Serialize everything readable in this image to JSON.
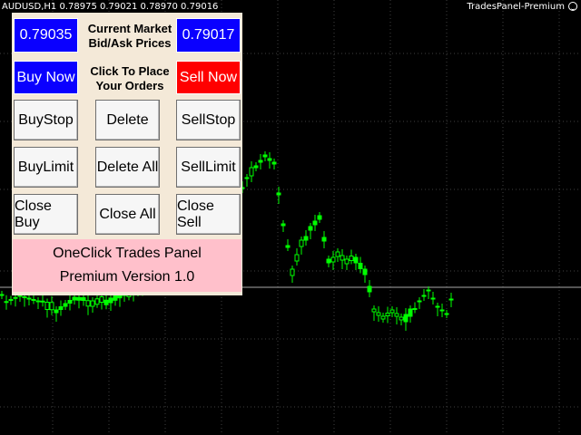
{
  "chart": {
    "symbol_label": "AUDUSD,H1  0.78975 0.79021 0.78970 0.79016",
    "ea_label": "TradesPanel-Premium",
    "smiley_icon": "smiley-face-icon",
    "background_color": "#000000",
    "grid_color": "#404040",
    "candle_color": "#00ff00",
    "price_line_color": "#a8a8a8"
  },
  "panel": {
    "bid_price": "0.79035",
    "ask_price": "0.79017",
    "prices_caption_line1": "Current Market",
    "prices_caption_line2": "Bid/Ask Prices",
    "orders_caption_line1": "Click To Place",
    "orders_caption_line2": "Your Orders",
    "buy_now_label": "Buy Now",
    "sell_now_label": "Sell Now",
    "buy_stop_label": "BuyStop",
    "delete_label": "Delete",
    "sell_stop_label": "SellStop",
    "buy_limit_label": "BuyLimit",
    "delete_all_label": "Delete All",
    "sell_limit_label": "SellLimit",
    "close_buy_label": "Close Buy",
    "close_all_label": "Close All",
    "close_sell_label": "Close Sell",
    "version_line1": "OneClick Trades Panel",
    "version_line2": "Premium Version 1.0",
    "panel_color": "#f4e9d8",
    "blue_color": "#0a00ff",
    "red_color": "#ff0000",
    "version_bg_color": "#ffc0cb"
  }
}
